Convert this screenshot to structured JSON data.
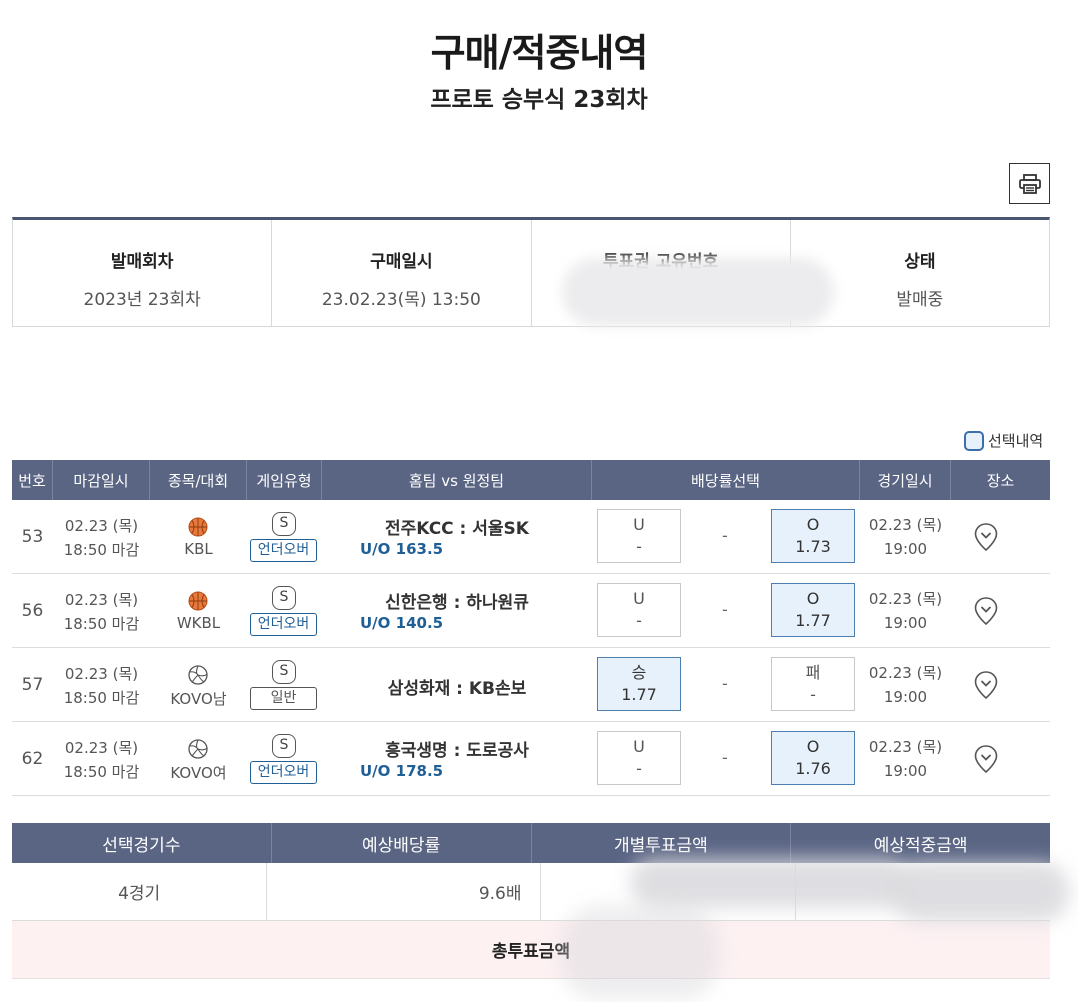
{
  "page": {
    "title": "구매/적중내역",
    "subtitle": "프로토 승부식 23회차"
  },
  "info": {
    "headers": [
      "발매회차",
      "구매일시",
      "투표권 고유번호",
      "상태"
    ],
    "values": [
      "2023년 23회차",
      "23.02.23(목) 13:50",
      "",
      "발매중"
    ]
  },
  "legend": {
    "label": "선택내역"
  },
  "table": {
    "headers": [
      "번호",
      "마감일시",
      "종목/대회",
      "게임유형",
      "홈팀 vs 원정팀",
      "배당률선택",
      "경기일시",
      "장소"
    ],
    "rows": [
      {
        "num": "53",
        "deadline_date": "02.23 (목)",
        "deadline_time": "18:50 마감",
        "sport": "basketball-icon",
        "league": "KBL",
        "game_icon": "S",
        "game_type": "언더오버",
        "match": "전주KCC : 서울SK",
        "handicap": "U/O 163.5",
        "left_label": "U",
        "left_value": "-",
        "dash": "-",
        "right_label": "O",
        "right_value": "1.73",
        "game_date": "02.23 (목)",
        "game_time": "19:00"
      },
      {
        "num": "56",
        "deadline_date": "02.23 (목)",
        "deadline_time": "18:50 마감",
        "sport": "basketball-icon",
        "league": "WKBL",
        "game_icon": "S",
        "game_type": "언더오버",
        "match": "신한은행 : 하나원큐",
        "handicap": "U/O 140.5",
        "left_label": "U",
        "left_value": "-",
        "dash": "-",
        "right_label": "O",
        "right_value": "1.77",
        "game_date": "02.23 (목)",
        "game_time": "19:00"
      },
      {
        "num": "57",
        "deadline_date": "02.23 (목)",
        "deadline_time": "18:50 마감",
        "sport": "volleyball-icon",
        "league": "KOVO남",
        "game_icon": "S",
        "game_type": "일반",
        "match": "삼성화재 : KB손보",
        "handicap": "",
        "left_label": "승",
        "left_value": "1.77",
        "dash": "-",
        "right_label": "패",
        "right_value": "-",
        "game_date": "02.23 (목)",
        "game_time": "19:00"
      },
      {
        "num": "62",
        "deadline_date": "02.23 (목)",
        "deadline_time": "18:50 마감",
        "sport": "volleyball-icon",
        "league": "KOVO여",
        "game_icon": "S",
        "game_type": "언더오버",
        "match": "흥국생명 : 도로공사",
        "handicap": "U/O 178.5",
        "left_label": "U",
        "left_value": "-",
        "dash": "-",
        "right_label": "O",
        "right_value": "1.76",
        "game_date": "02.23 (목)",
        "game_time": "19:00"
      }
    ]
  },
  "summary": {
    "headers": [
      "선택경기수",
      "예상배당률",
      "개별투표금액",
      "예상적중금액"
    ],
    "games_count": "4경기",
    "expected_rate": "9.6배",
    "total_label": "총투표금액"
  },
  "colors": {
    "header_bg": "#5a6584",
    "accent_blue": "#1f5f96",
    "selected_bg": "#e6f1fb",
    "total_bg": "#fdf1f2"
  },
  "icons": {
    "print": "printer-icon",
    "venue": "map-pin-icon"
  }
}
